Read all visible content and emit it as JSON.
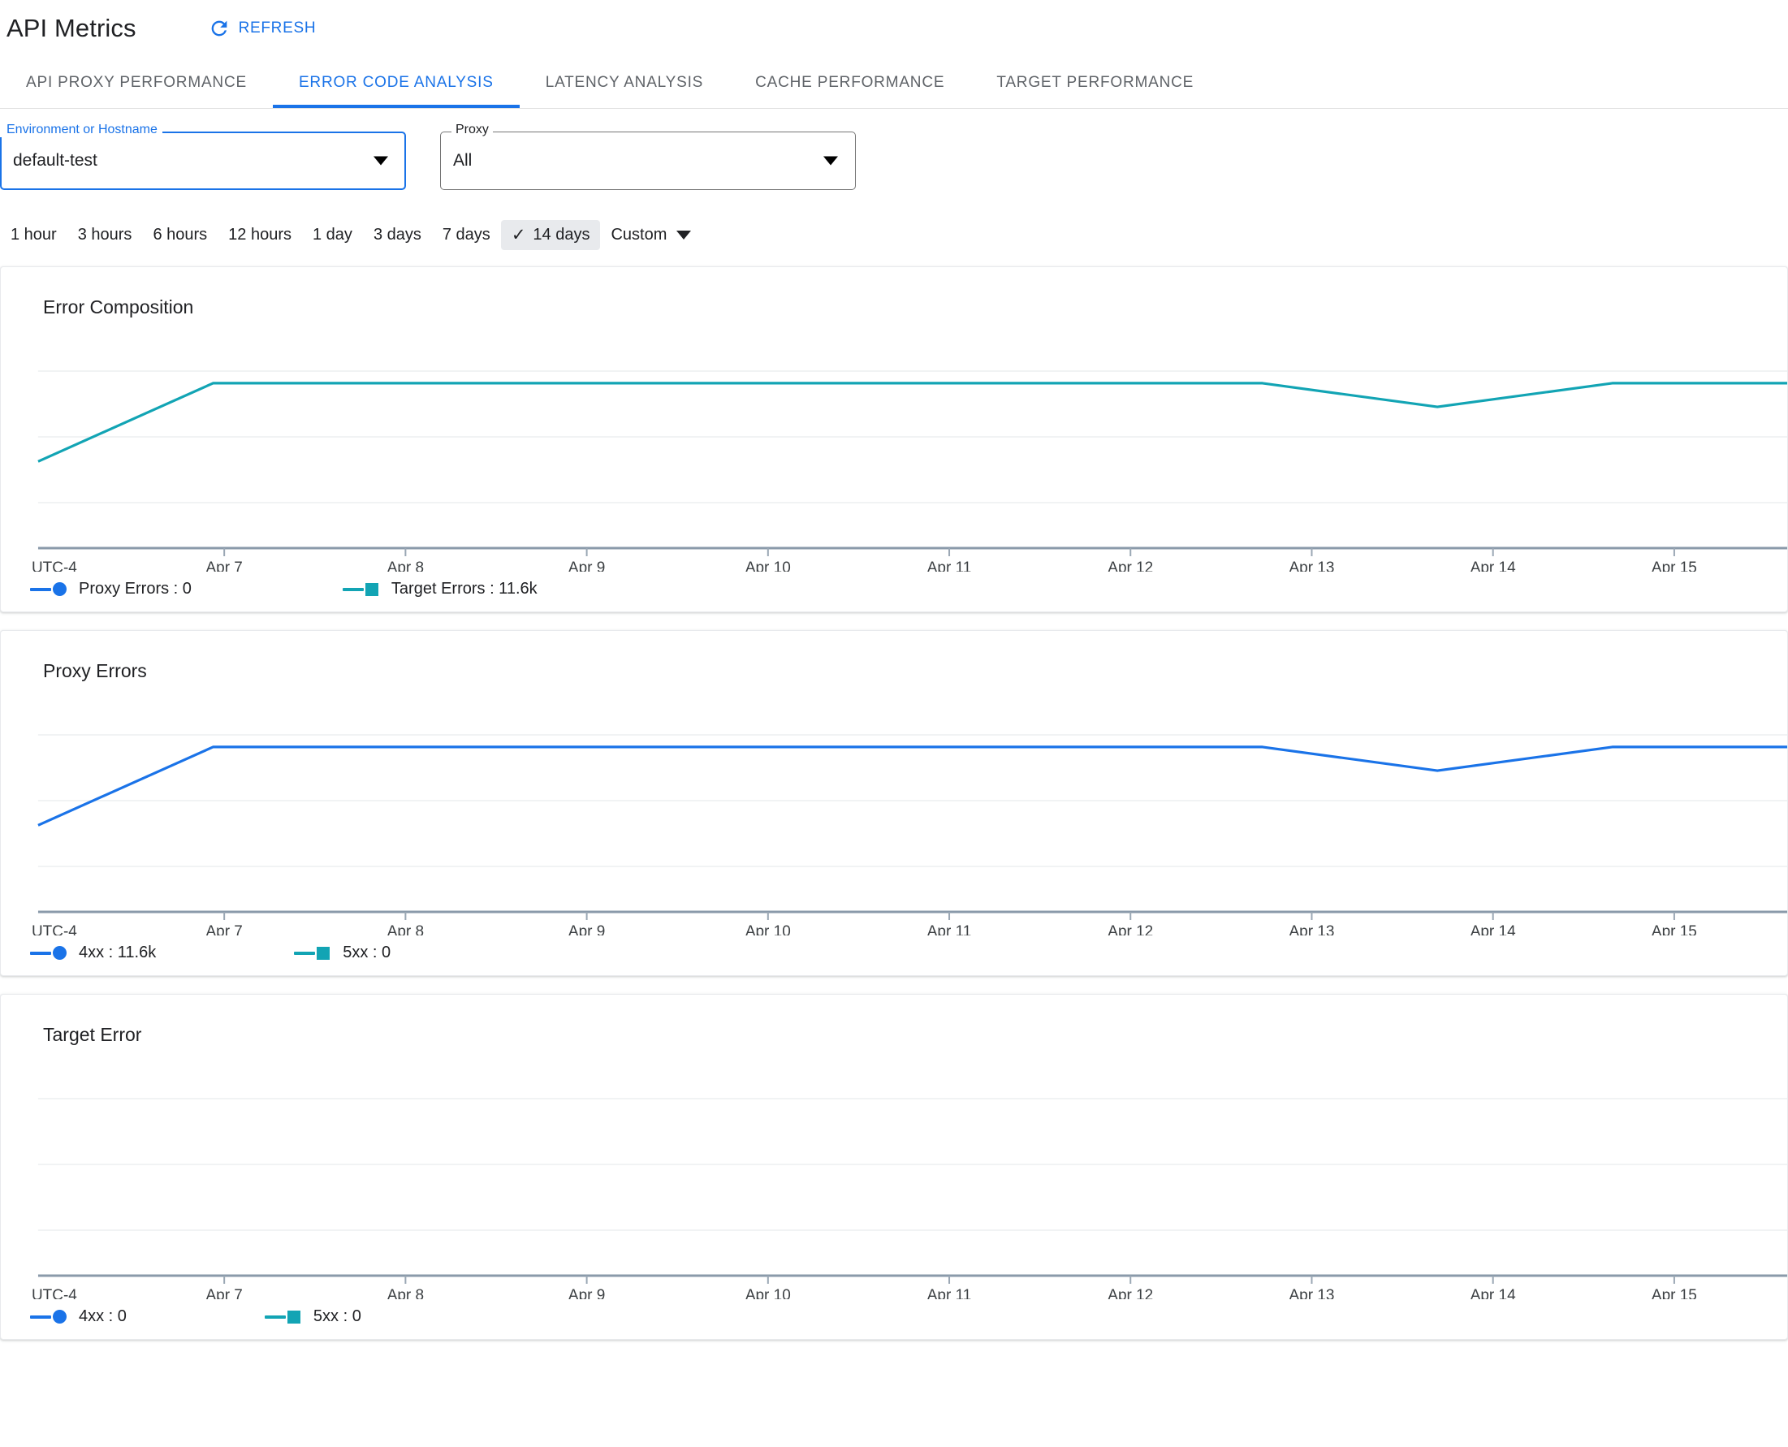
{
  "header": {
    "title": "API Metrics",
    "refresh_label": "REFRESH",
    "refresh_icon": "refresh-icon",
    "accent_color": "#1a73e8"
  },
  "tabs": [
    {
      "label": "API PROXY PERFORMANCE",
      "active": false
    },
    {
      "label": "ERROR CODE ANALYSIS",
      "active": true
    },
    {
      "label": "LATENCY ANALYSIS",
      "active": false
    },
    {
      "label": "CACHE PERFORMANCE",
      "active": false
    },
    {
      "label": "TARGET PERFORMANCE",
      "active": false
    }
  ],
  "filters": {
    "environment": {
      "label": "Environment or Hostname",
      "value": "default-test",
      "caret_icon": "chevron-down-icon",
      "focused": true
    },
    "proxy": {
      "label": "Proxy",
      "value": "All",
      "caret_icon": "chevron-down-icon",
      "focused": false
    }
  },
  "time_range": {
    "options": [
      "1 hour",
      "3 hours",
      "6 hours",
      "12 hours",
      "1 day",
      "3 days",
      "7 days",
      "14 days"
    ],
    "selected": "14 days",
    "check_glyph": "✓",
    "custom_label": "Custom",
    "custom_caret_icon": "chevron-down-icon"
  },
  "colors": {
    "proxy_blue": "#1a73e8",
    "target_teal": "#12a4b4",
    "grid": "#f1f3f4",
    "axis": "#8a9aaa"
  },
  "charts": [
    {
      "title": "Error Composition",
      "legend": [
        {
          "label": "Proxy Errors : 0",
          "color": "#1a73e8",
          "marker": "circle"
        },
        {
          "label": "Target Errors : 11.6k",
          "color": "#12a4b4",
          "marker": "square"
        }
      ]
    },
    {
      "title": "Proxy Errors",
      "legend": [
        {
          "label": "4xx : 11.6k",
          "color": "#1a73e8",
          "marker": "circle"
        },
        {
          "label": "5xx : 0",
          "color": "#12a4b4",
          "marker": "square"
        }
      ]
    },
    {
      "title": "Target Error",
      "legend": [
        {
          "label": "4xx : 0",
          "color": "#1a73e8",
          "marker": "circle"
        },
        {
          "label": "5xx : 0",
          "color": "#12a4b4",
          "marker": "square"
        }
      ]
    }
  ],
  "chart_data": [
    {
      "type": "line",
      "title": "Error Composition",
      "xlabel": "",
      "ylabel": "",
      "grid": true,
      "legend_position": "bottom",
      "timezone_label": "UTC-4",
      "tick_labels": [
        "UTC-4",
        "Apr 7",
        "Apr 8",
        "Apr 9",
        "Apr 10",
        "Apr 11",
        "Apr 12",
        "Apr 13",
        "Apr 14",
        "Apr 15"
      ],
      "x": [
        "Apr 6",
        "Apr 7",
        "Apr 8",
        "Apr 9",
        "Apr 10",
        "Apr 11",
        "Apr 12",
        "Apr 13",
        "Apr 14",
        "Apr 15",
        "Apr 16"
      ],
      "ylim": [
        0,
        1400
      ],
      "series": [
        {
          "name": "Proxy Errors",
          "color": "#1a73e8",
          "total": 0,
          "values": []
        },
        {
          "name": "Target Errors",
          "color": "#12a4b4",
          "total": "11.6k",
          "values": [
            620,
            1180,
            1180,
            1180,
            1180,
            1180,
            1180,
            1180,
            1010,
            1180,
            1180
          ]
        }
      ]
    },
    {
      "type": "line",
      "title": "Proxy Errors",
      "xlabel": "",
      "ylabel": "",
      "grid": true,
      "legend_position": "bottom",
      "timezone_label": "UTC-4",
      "tick_labels": [
        "UTC-4",
        "Apr 7",
        "Apr 8",
        "Apr 9",
        "Apr 10",
        "Apr 11",
        "Apr 12",
        "Apr 13",
        "Apr 14",
        "Apr 15"
      ],
      "x": [
        "Apr 6",
        "Apr 7",
        "Apr 8",
        "Apr 9",
        "Apr 10",
        "Apr 11",
        "Apr 12",
        "Apr 13",
        "Apr 14",
        "Apr 15",
        "Apr 16"
      ],
      "ylim": [
        0,
        1400
      ],
      "series": [
        {
          "name": "4xx",
          "color": "#1a73e8",
          "total": "11.6k",
          "values": [
            620,
            1180,
            1180,
            1180,
            1180,
            1180,
            1180,
            1180,
            1010,
            1180,
            1180
          ]
        },
        {
          "name": "5xx",
          "color": "#12a4b4",
          "total": 0,
          "values": []
        }
      ]
    },
    {
      "type": "line",
      "title": "Target Error",
      "xlabel": "",
      "ylabel": "",
      "grid": true,
      "legend_position": "bottom",
      "timezone_label": "UTC-4",
      "tick_labels": [
        "UTC-4",
        "Apr 7",
        "Apr 8",
        "Apr 9",
        "Apr 10",
        "Apr 11",
        "Apr 12",
        "Apr 13",
        "Apr 14",
        "Apr 15"
      ],
      "x": [
        "Apr 6",
        "Apr 7",
        "Apr 8",
        "Apr 9",
        "Apr 10",
        "Apr 11",
        "Apr 12",
        "Apr 13",
        "Apr 14",
        "Apr 15",
        "Apr 16"
      ],
      "ylim": [
        0,
        1400
      ],
      "series": [
        {
          "name": "4xx",
          "color": "#1a73e8",
          "total": 0,
          "values": []
        },
        {
          "name": "5xx",
          "color": "#12a4b4",
          "total": 0,
          "values": []
        }
      ]
    }
  ]
}
